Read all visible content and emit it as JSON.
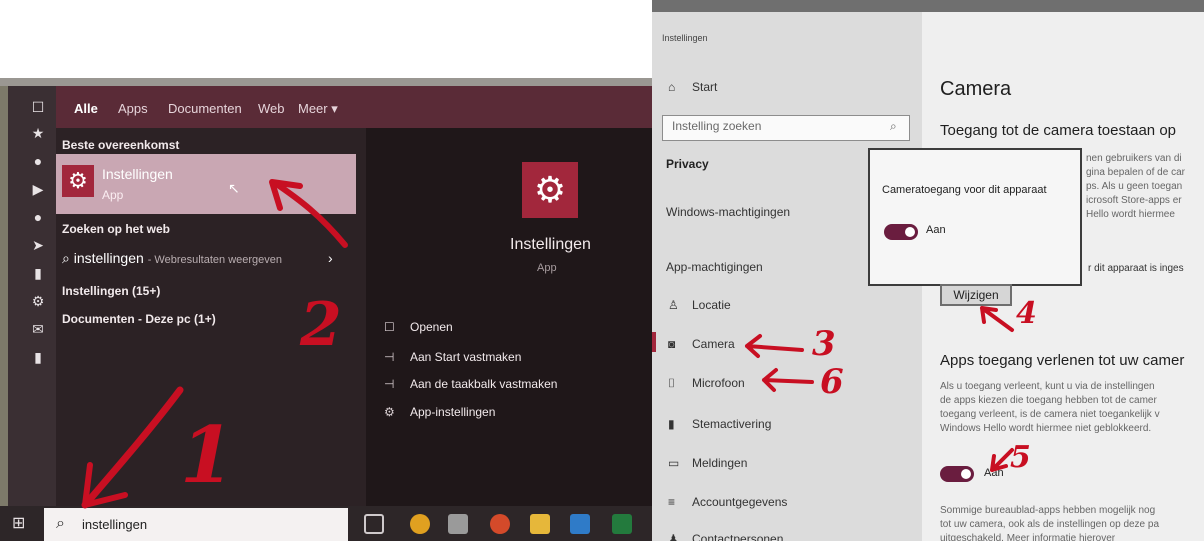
{
  "search_menu": {
    "tabs": [
      "Alle",
      "Apps",
      "Documenten",
      "Web",
      "Meer ▾"
    ],
    "best_match_header": "Beste overeenkomst",
    "best_match": {
      "title": "Instellingen",
      "subtitle": "App"
    },
    "web_header": "Zoeken op het web",
    "web_item": {
      "term": "instellingen",
      "suffix": "- Webresultaten weergeven"
    },
    "instellingen_count": "Instellingen (15+)",
    "documents_count": "Documenten - Deze pc (1+)",
    "detail": {
      "title": "Instellingen",
      "subtitle": "App"
    },
    "actions": [
      "Openen",
      "Aan Start vastmaken",
      "Aan de taakbalk vastmaken",
      "App-instellingen"
    ]
  },
  "taskbar": {
    "search_text": "instellingen"
  },
  "settings": {
    "app_title": "Instellingen",
    "nav_start": "Start",
    "search_placeholder": "Instelling zoeken",
    "privacy_header": "Privacy",
    "windows_permissions": "Windows-machtigingen",
    "app_permissions": "App-machtigingen",
    "nav_items": [
      "Locatie",
      "Camera",
      "Microfoon",
      "Stemactivering",
      "Meldingen",
      "Accountgegevens",
      "Contactpersonen"
    ],
    "page_title": "Camera",
    "heading1": "Toegang tot de camera toestaan op",
    "para1": [
      "nen gebruikers van di",
      "gina bepalen of de car",
      "ps. Als u geen toegan",
      "icrosoft Store-apps er",
      "Hello wordt hiermee"
    ],
    "device_line": "r dit apparaat is inges",
    "popup_label": "Cameratoegang voor dit apparaat",
    "popup_toggle_label": "Aan",
    "change_button": "Wijzigen",
    "heading2": "Apps toegang verlenen tot uw camer",
    "para2": [
      "Als u toegang verleent, kunt u via de instellingen",
      "de apps kiezen die toegang hebben tot de camer",
      "toegang verleent, is de camera niet toegankelijk v",
      "Windows Hello wordt hiermee niet geblokkeerd."
    ],
    "apps_toggle_label": "Aan",
    "para3": [
      "Sommige bureaublad-apps hebben mogelijk nog",
      "tot uw camera, ook als de instellingen op deze pa",
      "uitgeschakeld. Meer informatie hierover"
    ]
  },
  "annotations": [
    "1",
    "2",
    "3",
    "4",
    "5",
    "6"
  ],
  "colors": {
    "accent": "#a2273c",
    "menu": "#5a2b37",
    "toggle": "#6a1d3f",
    "annotation": "#c80f22"
  }
}
